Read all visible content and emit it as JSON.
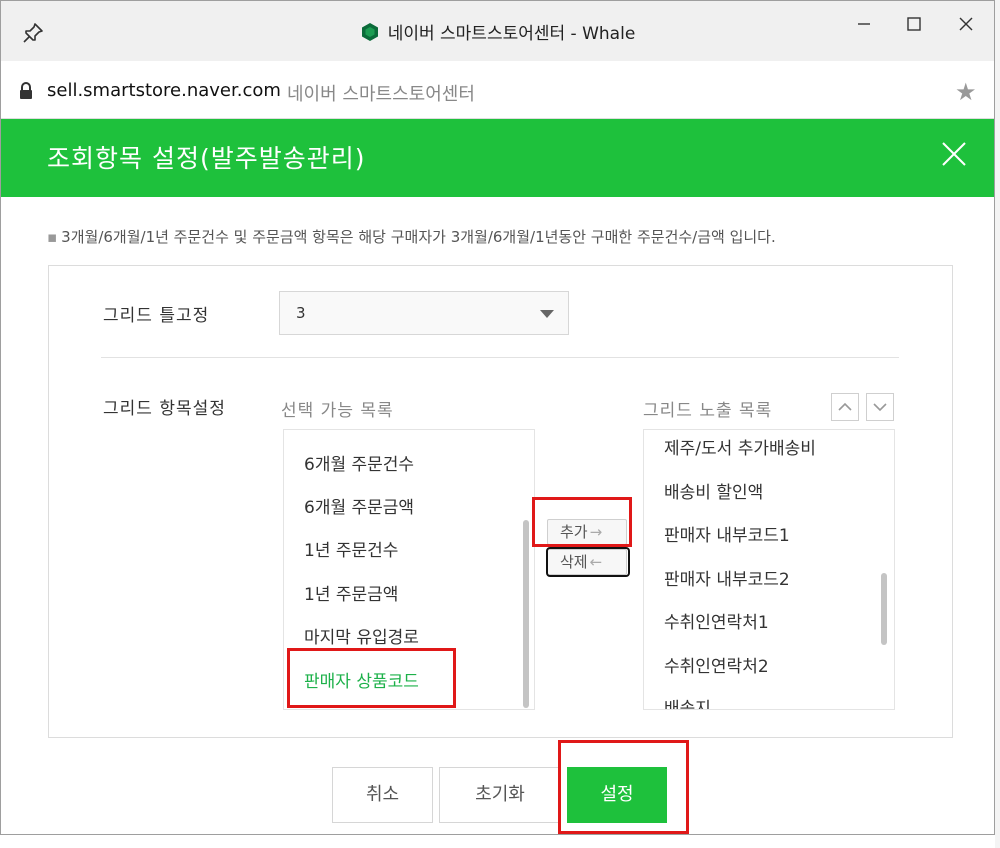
{
  "browser": {
    "window_title": "네이버 스마트스토어센터 - Whale",
    "url": "sell.smartstore.naver.com",
    "page_title": "네이버 스마트스토어센터"
  },
  "dialog": {
    "title": "조회항목 설정(발주발송관리)",
    "notice": "3개월/6개월/1년 주문건수 및 주문금액 항목은 해당 구매자가 3개월/6개월/1년동안 구매한 주문건수/금액 입니다.",
    "grid_fix_label": "그리드 틀고정",
    "grid_fix_value": "3",
    "grid_items_label": "그리드 항목설정",
    "available_label": "선택 가능 목록",
    "exposed_label": "그리드 노출 목록",
    "available_items": [
      "6개월 주문건수",
      "6개월 주문금액",
      "1년 주문건수",
      "1년 주문금액",
      "마지막 유입경로",
      "판매자 상품코드"
    ],
    "exposed_items": [
      "제주/도서 추가배송비",
      "배송비 할인액",
      "판매자 내부코드1",
      "판매자 내부코드2",
      "수취인연락처1",
      "수취인연락처2",
      "배송지"
    ],
    "add_label": "추가",
    "delete_label": "삭제",
    "cancel_label": "취소",
    "reset_label": "초기화",
    "confirm_label": "설정"
  },
  "colors": {
    "brand_green": "#1ec13c",
    "selected_text": "#1db14a",
    "highlight_red": "#e01818"
  }
}
